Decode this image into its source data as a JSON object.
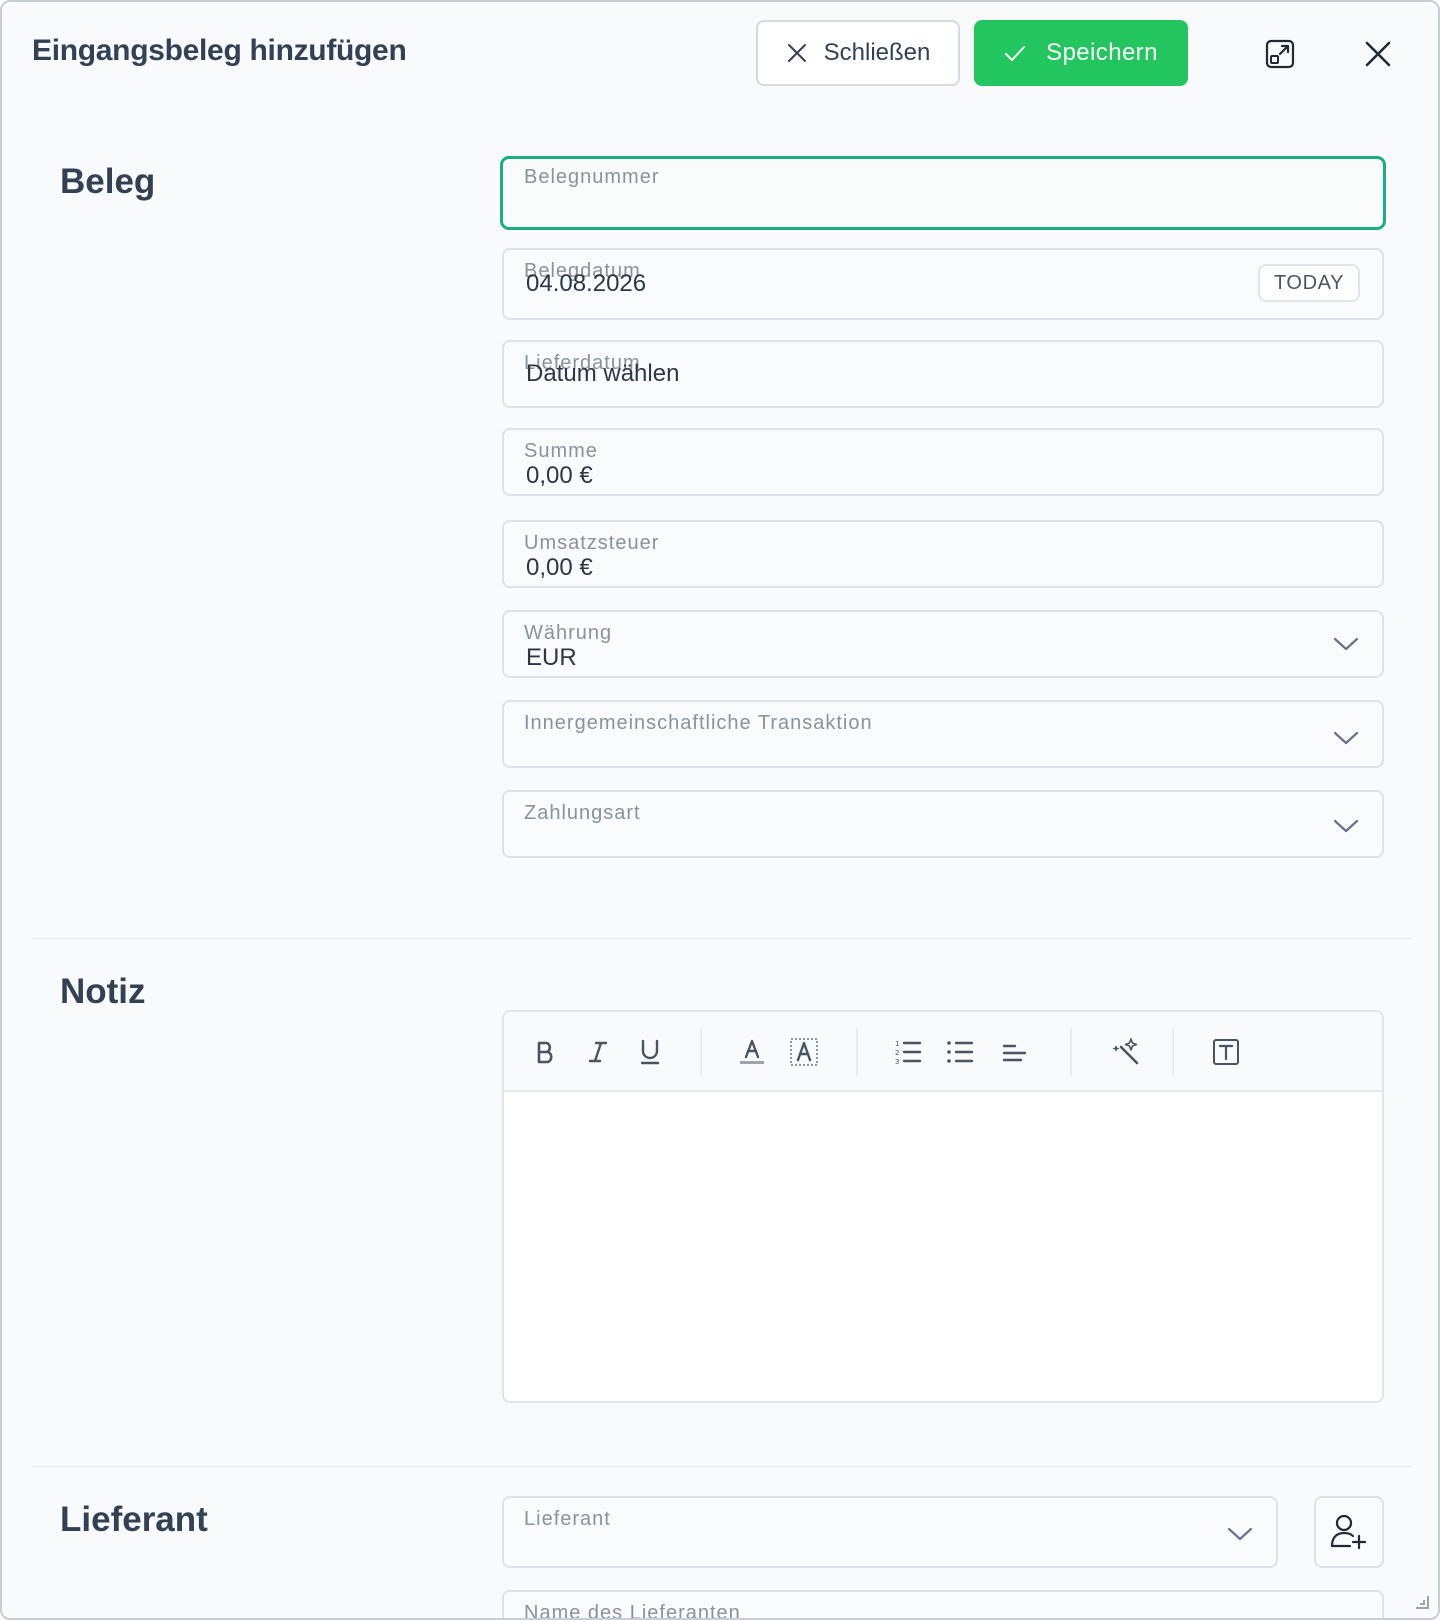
{
  "header": {
    "title": "Eingangsbeleg hinzufügen",
    "close_label": "Schließen",
    "save_label": "Speichern",
    "accent_color": "#22c55e"
  },
  "sections": {
    "beleg": "Beleg",
    "notiz": "Notiz",
    "lieferant": "Lieferant"
  },
  "fields": {
    "belegnummer": {
      "label": "Belegnummer",
      "value": ""
    },
    "belegdatum": {
      "label": "Belegdatum",
      "value": "04.08.2026",
      "today_label": "TODAY"
    },
    "lieferdatum": {
      "label": "Lieferdatum",
      "value": "Datum wählen"
    },
    "summe": {
      "label": "Summe",
      "value": "0,00 €"
    },
    "umsatzsteuer": {
      "label": "Umsatzsteuer",
      "value": "0,00 €"
    },
    "waehrung": {
      "label": "Währung",
      "value": "EUR"
    },
    "innergemeinschaftlich": {
      "label": "Innergemeinschaftliche Transaktion",
      "value": ""
    },
    "zahlungsart": {
      "label": "Zahlungsart",
      "value": ""
    },
    "lieferant": {
      "label": "Lieferant",
      "value": ""
    },
    "name_lieferant": {
      "label": "Name des Lieferanten",
      "value": ""
    }
  },
  "editor": {
    "toolbar": [
      "bold-icon",
      "italic-icon",
      "underline-icon",
      "font-color-icon",
      "highlight-icon",
      "ordered-list-icon",
      "bullet-list-icon",
      "align-left-icon",
      "magic-wand-icon",
      "text-box-icon"
    ],
    "content": ""
  }
}
